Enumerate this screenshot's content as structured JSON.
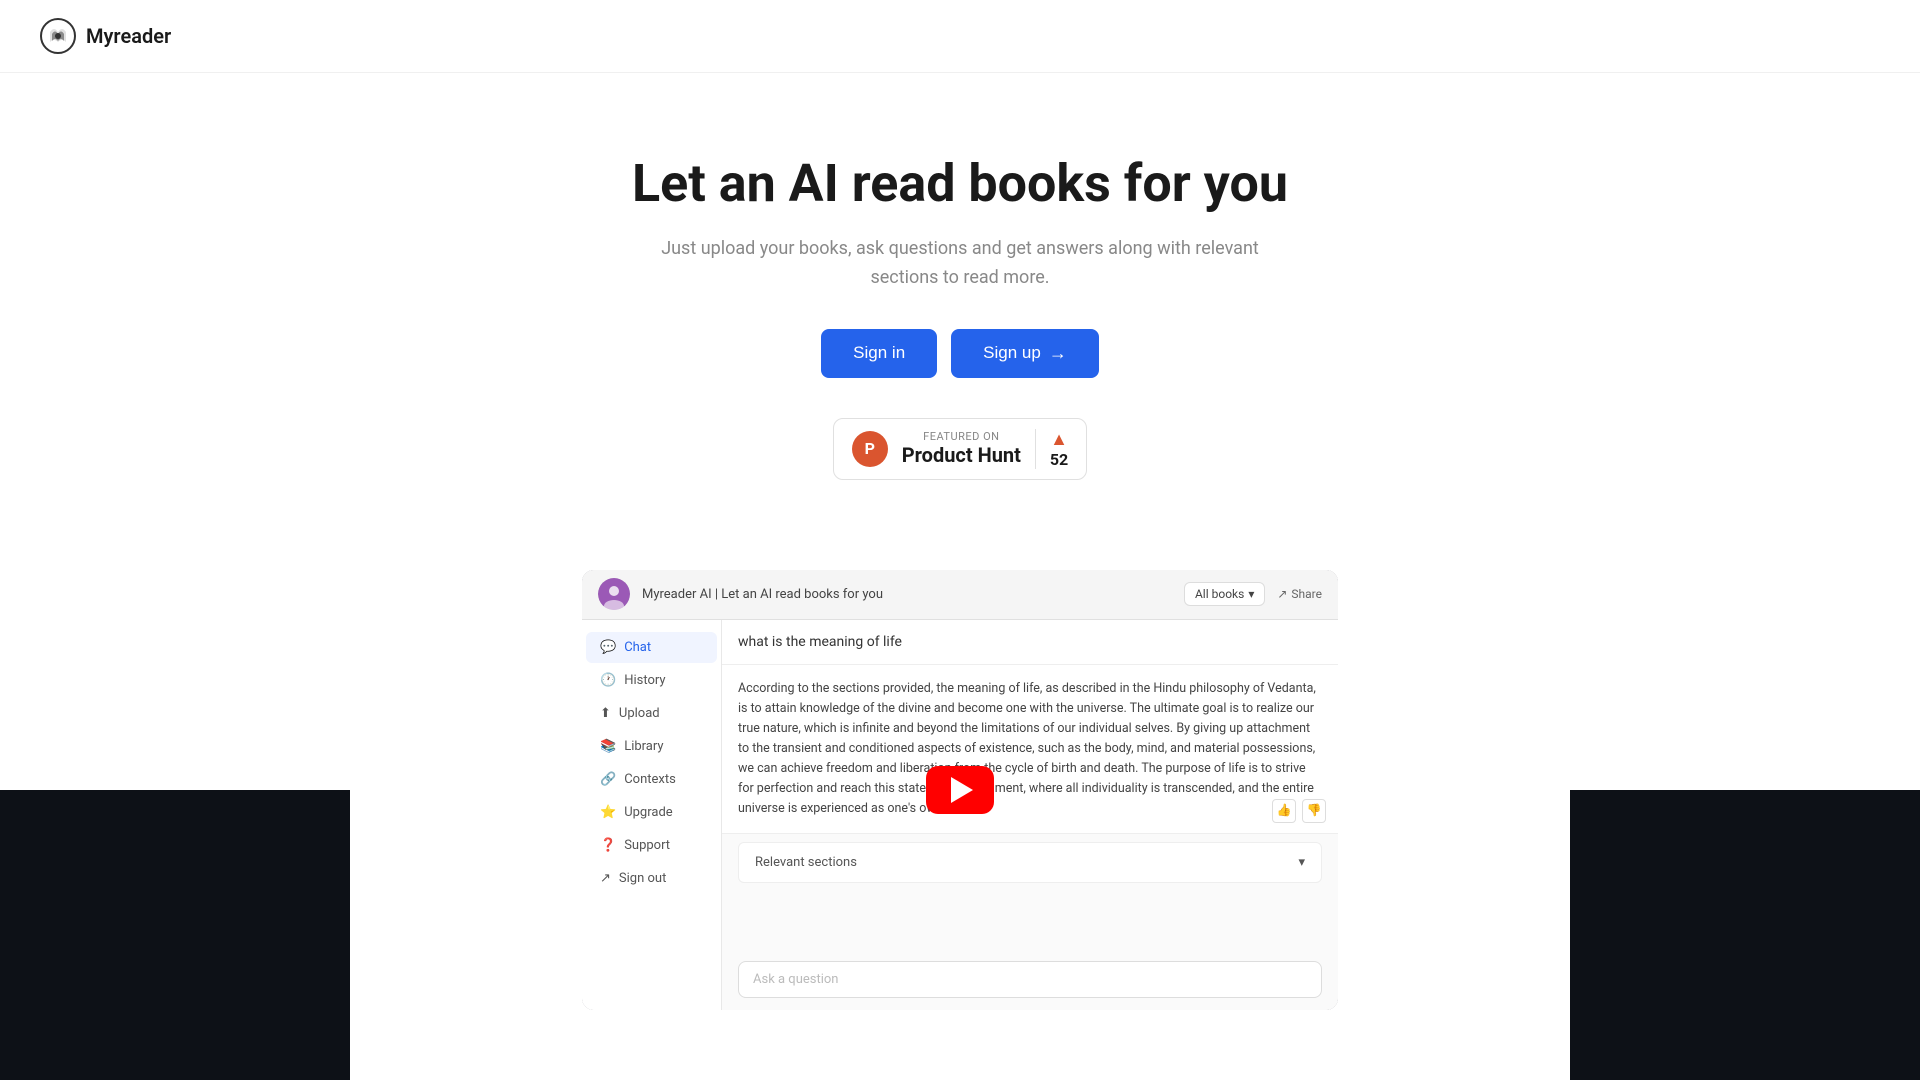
{
  "header": {
    "logo_text": "Myreader"
  },
  "hero": {
    "title": "Let an AI read books for you",
    "subtitle": "Just upload your books, ask questions and get answers along with relevant sections to read more.",
    "signin_label": "Sign in",
    "signup_label": "Sign up"
  },
  "product_hunt": {
    "featured_label": "FEATURED ON",
    "name": "Product Hunt",
    "count": "52"
  },
  "video": {
    "channel_title": "Myreader AI | Let an AI read books for you",
    "all_books_label": "All books",
    "share_label": "Share"
  },
  "app_sidebar": {
    "items": [
      {
        "label": "Chat",
        "icon": "💬",
        "active": true
      },
      {
        "label": "History",
        "icon": "🕐",
        "active": false
      },
      {
        "label": "Upload",
        "icon": "⬆",
        "active": false
      },
      {
        "label": "Library",
        "icon": "📚",
        "active": false
      },
      {
        "label": "Contexts",
        "icon": "🔗",
        "active": false
      },
      {
        "label": "Upgrade",
        "icon": "⭐",
        "active": false
      },
      {
        "label": "Support",
        "icon": "❓",
        "active": false
      },
      {
        "label": "Sign out",
        "icon": "↗",
        "active": false
      }
    ]
  },
  "app_main": {
    "question": "what is the meaning of life",
    "answer": "According to the sections provided, the meaning of life, as described in the Hindu philosophy of Vedanta, is to attain knowledge of the divine and become one with the universe. The ultimate goal is to realize our true nature, which is infinite and beyond the limitations of our individual selves. By giving up attachment to the transient and conditioned aspects of existence, such as the body, mind, and material possessions, we can achieve freedom and liberation from the cycle of birth and death. The purpose of life is to strive for perfection and reach this state of enlightenment, where all individuality is transcended, and the entire universe is experienced as one's own self.",
    "relevant_sections_label": "Relevant sections",
    "ask_placeholder": "Ask a question"
  }
}
